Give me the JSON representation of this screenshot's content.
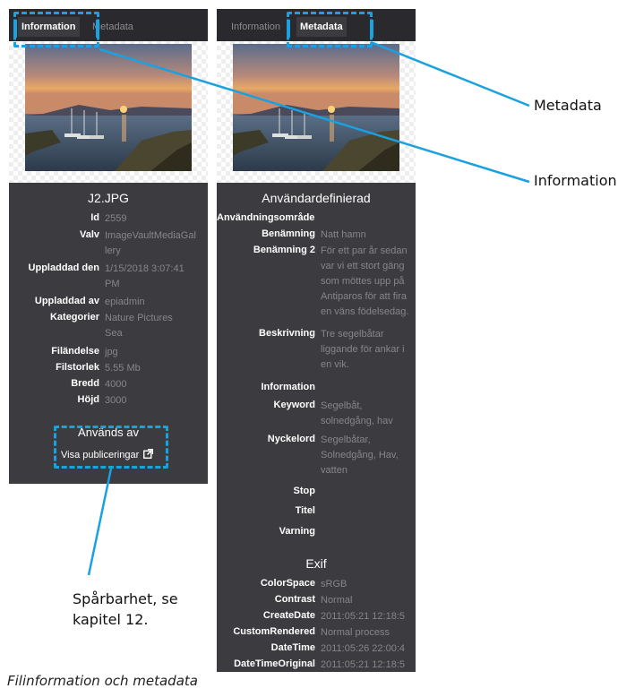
{
  "left_panel": {
    "tabs": [
      {
        "label": "Information",
        "active": true
      },
      {
        "label": "Metadata",
        "active": false
      }
    ],
    "file_title": "J2.JPG",
    "rows": [
      {
        "label": "Id",
        "value": "2559"
      },
      {
        "label": "Valv",
        "value": "ImageVaultMediaGal\nlery"
      },
      {
        "label": "Uppladdad den",
        "value": "1/15/2018 3:07:41\nPM"
      },
      {
        "label": "Uppladdad av",
        "value": "epiadmin"
      },
      {
        "label": "Kategorier",
        "value": "Nature Pictures\nSea"
      },
      {
        "label": "Filändelse",
        "value": "jpg"
      },
      {
        "label": "Filstorlek",
        "value": "5.55 Mb"
      },
      {
        "label": "Bredd",
        "value": "4000"
      },
      {
        "label": "Höjd",
        "value": "3000"
      }
    ],
    "anvands_av": "Används av",
    "visa_link": "Visa publiceringar",
    "visa_icon": "external-link-icon"
  },
  "right_panel": {
    "tabs": [
      {
        "label": "Information",
        "active": false
      },
      {
        "label": "Metadata",
        "active": true
      }
    ],
    "section_user": "Användardefinierad",
    "user_rows": [
      {
        "label": "Användningsområde",
        "value": ""
      },
      {
        "label": "Benämning",
        "value": "Natt hamn"
      },
      {
        "label": "Benämning 2",
        "value": "För ett par år sedan\nvar vi ett stort gäng\nsom möttes upp på\nAntiparos för att fira\nen väns födelsedag."
      },
      {
        "label": "Beskrivning",
        "value": "Tre segelbåtar\nliggande för ankar i\nen vik."
      },
      {
        "label": "Information",
        "value": ""
      },
      {
        "label": "Keyword",
        "value": "Segelbåt,\nsolnedgång, hav"
      },
      {
        "label": "Nyckelord",
        "value": "Segelbåtar,\nSolnedgång, Hav,\nvatten"
      },
      {
        "label": "Stop",
        "value": ""
      },
      {
        "label": "Titel",
        "value": ""
      },
      {
        "label": "Varning",
        "value": ""
      }
    ],
    "section_exif": "Exif",
    "exif_rows": [
      {
        "label": "ColorSpace",
        "value": "sRGB"
      },
      {
        "label": "Contrast",
        "value": "Normal"
      },
      {
        "label": "CreateDate",
        "value": "2011:05:21 12:18:5"
      },
      {
        "label": "CustomRendered",
        "value": "Normal process"
      },
      {
        "label": "DateTime",
        "value": "2011:05:26 22:00:4"
      },
      {
        "label": "DateTimeOriginal",
        "value": "2011:05:21 12:18:5"
      }
    ]
  },
  "annotations": {
    "metadata": "Metadata",
    "information": "Information",
    "sparbarhet_line1": "Spårbarhet, se",
    "sparbarhet_line2": "kapitel 12.",
    "caption": "Filinformation och metadata"
  },
  "colors": {
    "panel": "#3c3c40",
    "tabbar": "#2a2a2e",
    "callout": "#1aa1e0"
  }
}
